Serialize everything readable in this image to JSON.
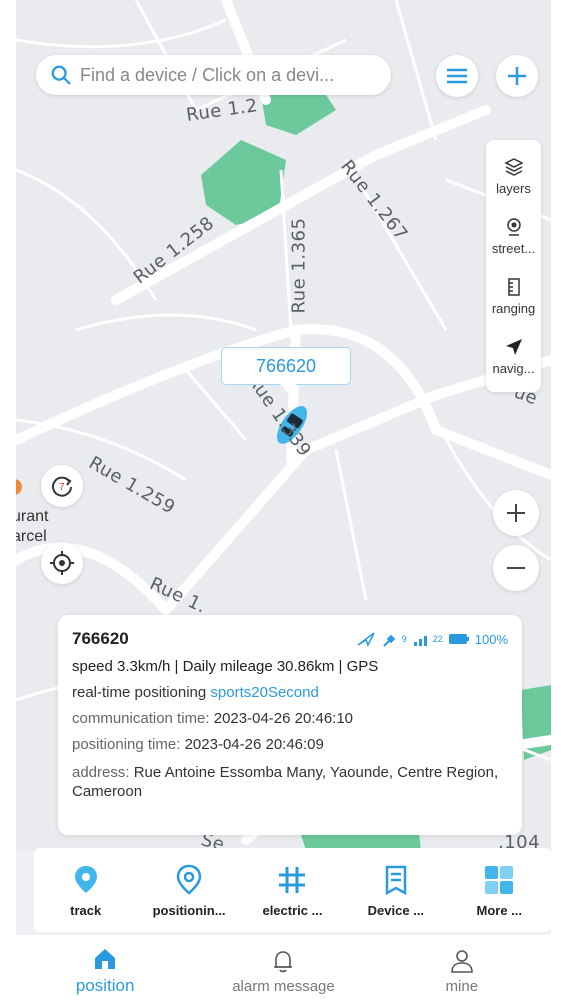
{
  "search": {
    "placeholder": "Find a device / Click on a devi..."
  },
  "map_tools": [
    {
      "label": "layers",
      "icon": "layers-icon"
    },
    {
      "label": "street...",
      "icon": "street-view-icon"
    },
    {
      "label": "ranging",
      "icon": "ruler-icon"
    },
    {
      "label": "navig...",
      "icon": "navigation-arrow-icon"
    }
  ],
  "streets": {
    "s1": "Rue 1.2",
    "s2": "Rue 1.267",
    "s3": "Rue 1.258",
    "s4": "Rue 1.365",
    "s5": "Rue 1.259",
    "s6": "Rue 1.339",
    "s7": "Rue 1.",
    "s8": "ue",
    "s9": ".104",
    "s10": "Se"
  },
  "poi_partial": {
    "line1": "urant",
    "line2": "arcel"
  },
  "refresh_badge": "7",
  "device_callout": "766620",
  "device": {
    "name": "766620",
    "satellites": "9",
    "signal": "22",
    "battery": "100%",
    "speed_line": "speed 3.3km/h  |  Daily mileage 30.86km  |  GPS",
    "realtime_label": "real-time positioning",
    "realtime_value": "sports20Second",
    "comm_label": "communication time:",
    "comm_value": "2023-04-26 20:46:10",
    "pos_label": "positioning time:",
    "pos_value": "2023-04-26 20:46:09",
    "address_label": "address:",
    "address_value": "Rue Antoine Essomba Many, Yaounde, Centre Region, Cameroon"
  },
  "toolbar": [
    {
      "label": "track",
      "icon": "location-pin-icon"
    },
    {
      "label": "positionin...",
      "icon": "positioning-icon"
    },
    {
      "label": "electric ...",
      "icon": "electric-fence-icon"
    },
    {
      "label": "Device ...",
      "icon": "device-info-icon"
    },
    {
      "label": "More ...",
      "icon": "more-grid-icon"
    }
  ],
  "tabs": [
    {
      "label": "position",
      "icon": "home-icon",
      "active": true
    },
    {
      "label": "alarm message",
      "icon": "bell-icon",
      "active": false
    },
    {
      "label": "mine",
      "icon": "user-icon",
      "active": false
    }
  ],
  "colors": {
    "accent": "#2a9ae0",
    "park": "#6cc99b",
    "map_bg": "#e9ebee"
  }
}
